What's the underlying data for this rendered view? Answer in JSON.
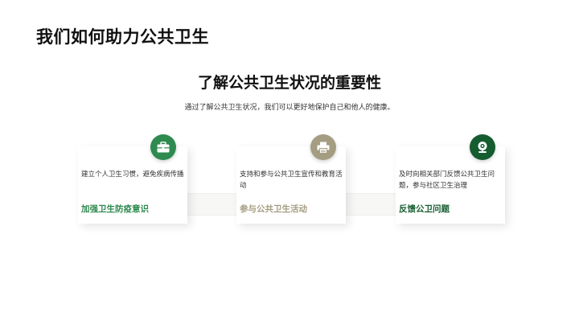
{
  "slide": {
    "title": "我们如何助力公共卫生",
    "heading": "了解公共卫生状况的重要性",
    "subtitle": "通过了解公共卫生状况，我们可以更好地保护自己和他人的健康。"
  },
  "cards": [
    {
      "icon": "briefcase-icon",
      "color": "#2e8a4f",
      "body": "建立个人卫生习惯，避免疾病传播",
      "label": "加强卫生防疫意识"
    },
    {
      "icon": "printer-icon",
      "color": "#a59d82",
      "body": "支持和参与公共卫生宣传和教育活动",
      "label": "参与公共卫生活动"
    },
    {
      "icon": "webcam-icon",
      "color": "#155c2f",
      "body": "及时向相关部门反馈公共卫生问题，参与社区卫生治理",
      "label": "反馈公卫问题"
    }
  ]
}
